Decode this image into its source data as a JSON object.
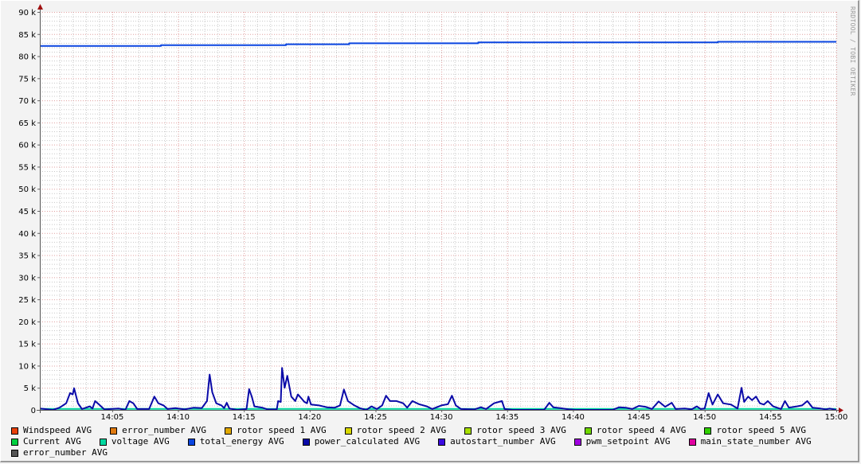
{
  "watermark": "RRDTOOL / TOBI OETIKER",
  "chart_data": {
    "type": "line",
    "title": "",
    "xlabel": "",
    "ylabel": "",
    "ylim": [
      0,
      90000
    ],
    "xlim_minutes": [
      -0.5,
      60
    ],
    "grid": true,
    "legend_placement": "bottom",
    "y_ticks": [
      {
        "v": 0,
        "label": "0"
      },
      {
        "v": 5000,
        "label": "5 k"
      },
      {
        "v": 10000,
        "label": "10 k"
      },
      {
        "v": 15000,
        "label": "15 k"
      },
      {
        "v": 20000,
        "label": "20 k"
      },
      {
        "v": 25000,
        "label": "25 k"
      },
      {
        "v": 30000,
        "label": "30 k"
      },
      {
        "v": 35000,
        "label": "35 k"
      },
      {
        "v": 40000,
        "label": "40 k"
      },
      {
        "v": 45000,
        "label": "45 k"
      },
      {
        "v": 50000,
        "label": "50 k"
      },
      {
        "v": 55000,
        "label": "55 k"
      },
      {
        "v": 60000,
        "label": "60 k"
      },
      {
        "v": 65000,
        "label": "65 k"
      },
      {
        "v": 70000,
        "label": "70 k"
      },
      {
        "v": 75000,
        "label": "75 k"
      },
      {
        "v": 80000,
        "label": "80 k"
      },
      {
        "v": 85000,
        "label": "85 k"
      },
      {
        "v": 90000,
        "label": "90 k"
      }
    ],
    "x_ticks": [
      {
        "m": 5,
        "label": "14:05"
      },
      {
        "m": 10,
        "label": "14:10"
      },
      {
        "m": 15,
        "label": "14:15"
      },
      {
        "m": 20,
        "label": "14:20"
      },
      {
        "m": 25,
        "label": "14:25"
      },
      {
        "m": 30,
        "label": "14:30"
      },
      {
        "m": 35,
        "label": "14:35"
      },
      {
        "m": 40,
        "label": "14:40"
      },
      {
        "m": 45,
        "label": "14:45"
      },
      {
        "m": 50,
        "label": "14:50"
      },
      {
        "m": 55,
        "label": "14:55"
      },
      {
        "m": 60,
        "label": "15:00"
      }
    ],
    "series": [
      {
        "name": "total_energy AVG",
        "color": "#0a45e0",
        "points": [
          [
            -0.5,
            82300
          ],
          [
            8.7,
            82300
          ],
          [
            8.7,
            82500
          ],
          [
            18.2,
            82500
          ],
          [
            18.2,
            82700
          ],
          [
            23.0,
            82700
          ],
          [
            23.0,
            82900
          ],
          [
            32.8,
            82900
          ],
          [
            32.8,
            83100
          ],
          [
            51.0,
            83100
          ],
          [
            51.0,
            83250
          ],
          [
            60,
            83250
          ]
        ]
      },
      {
        "name": "power_calculated AVG",
        "color": "#0a0aa8",
        "points": [
          [
            -0.5,
            300
          ],
          [
            0.5,
            0
          ],
          [
            1,
            500
          ],
          [
            1.5,
            1500
          ],
          [
            1.8,
            3800
          ],
          [
            2.0,
            3500
          ],
          [
            2.1,
            4900
          ],
          [
            2.4,
            1500
          ],
          [
            2.7,
            200
          ],
          [
            3.3,
            800
          ],
          [
            3.5,
            300
          ],
          [
            3.7,
            2000
          ],
          [
            4.0,
            1200
          ],
          [
            4.4,
            100
          ],
          [
            5.5,
            300
          ],
          [
            6.0,
            0
          ],
          [
            6.3,
            2000
          ],
          [
            6.6,
            1500
          ],
          [
            6.9,
            200
          ],
          [
            7.8,
            200
          ],
          [
            8.2,
            3000
          ],
          [
            8.5,
            1500
          ],
          [
            8.9,
            1000
          ],
          [
            9.2,
            200
          ],
          [
            9.8,
            400
          ],
          [
            10.5,
            100
          ],
          [
            11.2,
            500
          ],
          [
            11.8,
            400
          ],
          [
            12.2,
            2000
          ],
          [
            12.4,
            8000
          ],
          [
            12.6,
            4000
          ],
          [
            12.9,
            1500
          ],
          [
            13.3,
            1000
          ],
          [
            13.5,
            400
          ],
          [
            13.7,
            1600
          ],
          [
            13.9,
            300
          ],
          [
            14.5,
            0
          ],
          [
            15.2,
            200
          ],
          [
            15.4,
            4700
          ],
          [
            15.6,
            3000
          ],
          [
            15.8,
            800
          ],
          [
            16.4,
            500
          ],
          [
            16.8,
            100
          ],
          [
            17.5,
            100
          ],
          [
            17.6,
            2000
          ],
          [
            17.8,
            1800
          ],
          [
            17.9,
            9500
          ],
          [
            18.1,
            5000
          ],
          [
            18.3,
            7700
          ],
          [
            18.6,
            3000
          ],
          [
            18.9,
            2000
          ],
          [
            19.1,
            3500
          ],
          [
            19.4,
            2500
          ],
          [
            19.6,
            1800
          ],
          [
            19.8,
            1500
          ],
          [
            19.9,
            3000
          ],
          [
            20.1,
            1200
          ],
          [
            20.7,
            1000
          ],
          [
            21.3,
            600
          ],
          [
            21.9,
            500
          ],
          [
            22.3,
            1000
          ],
          [
            22.6,
            4600
          ],
          [
            22.9,
            2000
          ],
          [
            23.4,
            1000
          ],
          [
            23.8,
            400
          ],
          [
            24.3,
            0
          ],
          [
            24.7,
            800
          ],
          [
            25.1,
            200
          ],
          [
            25.5,
            1000
          ],
          [
            25.8,
            3200
          ],
          [
            26.1,
            2000
          ],
          [
            26.6,
            2000
          ],
          [
            27.1,
            1500
          ],
          [
            27.4,
            500
          ],
          [
            27.8,
            2000
          ],
          [
            28.3,
            1300
          ],
          [
            28.9,
            800
          ],
          [
            29.3,
            200
          ],
          [
            30.0,
            1000
          ],
          [
            30.5,
            1300
          ],
          [
            30.8,
            3200
          ],
          [
            31.1,
            1000
          ],
          [
            31.5,
            200
          ],
          [
            32.5,
            100
          ],
          [
            33.0,
            600
          ],
          [
            33.4,
            200
          ],
          [
            34.0,
            1500
          ],
          [
            34.6,
            2000
          ],
          [
            34.8,
            200
          ],
          [
            35.4,
            0
          ],
          [
            37.8,
            0
          ],
          [
            38.2,
            1600
          ],
          [
            38.5,
            600
          ],
          [
            39.0,
            400
          ],
          [
            39.7,
            100
          ],
          [
            40.2,
            0
          ],
          [
            43.0,
            0
          ],
          [
            43.5,
            600
          ],
          [
            44.0,
            500
          ],
          [
            44.5,
            200
          ],
          [
            45.0,
            900
          ],
          [
            45.5,
            700
          ],
          [
            46.0,
            200
          ],
          [
            46.5,
            1900
          ],
          [
            47.0,
            700
          ],
          [
            47.5,
            1600
          ],
          [
            47.8,
            200
          ],
          [
            48.5,
            300
          ],
          [
            49.0,
            100
          ],
          [
            49.4,
            800
          ],
          [
            49.7,
            200
          ],
          [
            50.0,
            300
          ],
          [
            50.3,
            3800
          ],
          [
            50.6,
            1200
          ],
          [
            51.0,
            3500
          ],
          [
            51.4,
            1500
          ],
          [
            52.0,
            1200
          ],
          [
            52.5,
            300
          ],
          [
            52.8,
            5000
          ],
          [
            53.0,
            1800
          ],
          [
            53.3,
            3000
          ],
          [
            53.6,
            2200
          ],
          [
            53.9,
            3000
          ],
          [
            54.2,
            1500
          ],
          [
            54.5,
            1200
          ],
          [
            54.8,
            2000
          ],
          [
            55.2,
            800
          ],
          [
            55.8,
            200
          ],
          [
            56.1,
            2000
          ],
          [
            56.4,
            500
          ],
          [
            57.0,
            800
          ],
          [
            57.4,
            1000
          ],
          [
            57.8,
            2000
          ],
          [
            58.2,
            500
          ],
          [
            58.8,
            300
          ],
          [
            59.2,
            100
          ],
          [
            59.5,
            300
          ],
          [
            60,
            0
          ]
        ]
      },
      {
        "name": "voltage AVG",
        "color": "#00d8a0",
        "points": [
          [
            -0.5,
            230
          ],
          [
            60,
            230
          ]
        ]
      }
    ]
  },
  "legend": [
    [
      {
        "label": "Windspeed AVG",
        "color": "#e8400a"
      },
      {
        "label": "error_number AVG",
        "color": "#e07a10"
      },
      {
        "label": "rotor speed 1 AVG",
        "color": "#e0a800"
      },
      {
        "label": "rotor speed 2 AVG",
        "color": "#d8d800"
      },
      {
        "label": "rotor speed 3 AVG",
        "color": "#a8e000"
      },
      {
        "label": "rotor speed 4 AVG",
        "color": "#70d800"
      },
      {
        "label": "rotor speed 5 AVG",
        "color": "#30d000"
      }
    ],
    [
      {
        "label": "Current AVG",
        "color": "#00d040"
      },
      {
        "label": "voltage AVG",
        "color": "#00d8a0"
      },
      {
        "label": "total_energy AVG",
        "color": "#0a45e0"
      },
      {
        "label": "power_calculated AVG",
        "color": "#0a0aa8"
      },
      {
        "label": "autostart_number AVG",
        "color": "#3a0ae0"
      },
      {
        "label": "pwm_setpoint AVG",
        "color": "#a000e0"
      },
      {
        "label": "main_state_number AVG",
        "color": "#e000a0"
      }
    ],
    [
      {
        "label": "error_number AVG",
        "color": "#555555"
      }
    ]
  ]
}
